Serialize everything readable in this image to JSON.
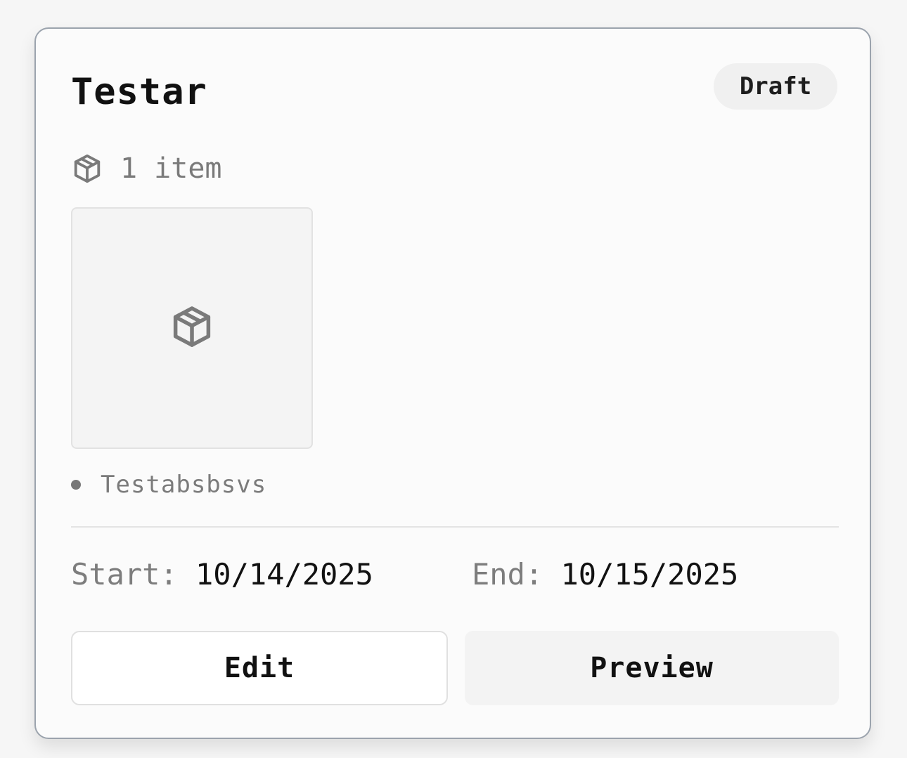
{
  "card": {
    "title": "Testar",
    "status": "Draft",
    "item_count": "1 item",
    "items": [
      {
        "name": "Testabsbsvs"
      }
    ],
    "start": {
      "label": "Start:",
      "value": "10/14/2025"
    },
    "end": {
      "label": "End:",
      "value": "10/15/2025"
    },
    "actions": {
      "edit_label": "Edit",
      "preview_label": "Preview"
    }
  },
  "icons": {
    "count": "package-icon",
    "thumbnail": "package-icon"
  },
  "colors": {
    "card_border": "#9ba3ad",
    "muted_text": "#7a7a7a",
    "badge_bg": "#f0f0f0"
  }
}
